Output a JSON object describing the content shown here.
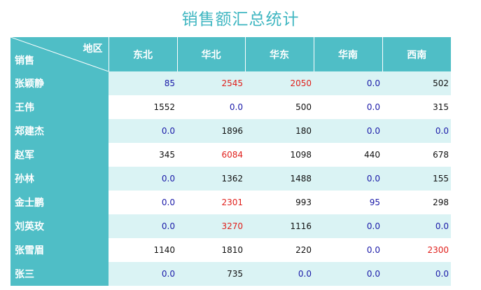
{
  "title": "销售额汇总统计",
  "header": {
    "corner_region": "地区",
    "corner_sales": "销售",
    "regions": [
      "东北",
      "华北",
      "华东",
      "华南",
      "西南"
    ]
  },
  "rows": [
    {
      "name": "张颖静",
      "values": [
        "85",
        "2545",
        "2050",
        "0.0",
        "502"
      ],
      "styles": [
        "zero",
        "high",
        "high",
        "zero",
        "normal"
      ]
    },
    {
      "name": "王伟",
      "values": [
        "1552",
        "0.0",
        "500",
        "0.0",
        "315"
      ],
      "styles": [
        "normal",
        "zero",
        "normal",
        "zero",
        "normal"
      ]
    },
    {
      "name": "郑建杰",
      "values": [
        "0.0",
        "1896",
        "180",
        "0.0",
        "0.0"
      ],
      "styles": [
        "zero",
        "normal",
        "normal",
        "zero",
        "zero"
      ]
    },
    {
      "name": "赵军",
      "values": [
        "345",
        "6084",
        "1098",
        "440",
        "678"
      ],
      "styles": [
        "normal",
        "high",
        "normal",
        "normal",
        "normal"
      ]
    },
    {
      "name": "孙林",
      "values": [
        "0.0",
        "1362",
        "1488",
        "0.0",
        "155"
      ],
      "styles": [
        "zero",
        "normal",
        "normal",
        "zero",
        "normal"
      ]
    },
    {
      "name": "金士鹏",
      "values": [
        "0.0",
        "2301",
        "993",
        "95",
        "298"
      ],
      "styles": [
        "zero",
        "high",
        "normal",
        "zero",
        "normal"
      ]
    },
    {
      "name": "刘英玫",
      "values": [
        "0.0",
        "3270",
        "1116",
        "0.0",
        "0.0"
      ],
      "styles": [
        "zero",
        "high",
        "normal",
        "zero",
        "zero"
      ]
    },
    {
      "name": "张雪眉",
      "values": [
        "1140",
        "1810",
        "220",
        "0.0",
        "2300"
      ],
      "styles": [
        "normal",
        "normal",
        "normal",
        "zero",
        "high"
      ]
    },
    {
      "name": "张三",
      "values": [
        "0.0",
        "735",
        "0.0",
        "0.0",
        "0.0"
      ],
      "styles": [
        "zero",
        "normal",
        "zero",
        "zero",
        "zero"
      ]
    }
  ]
}
